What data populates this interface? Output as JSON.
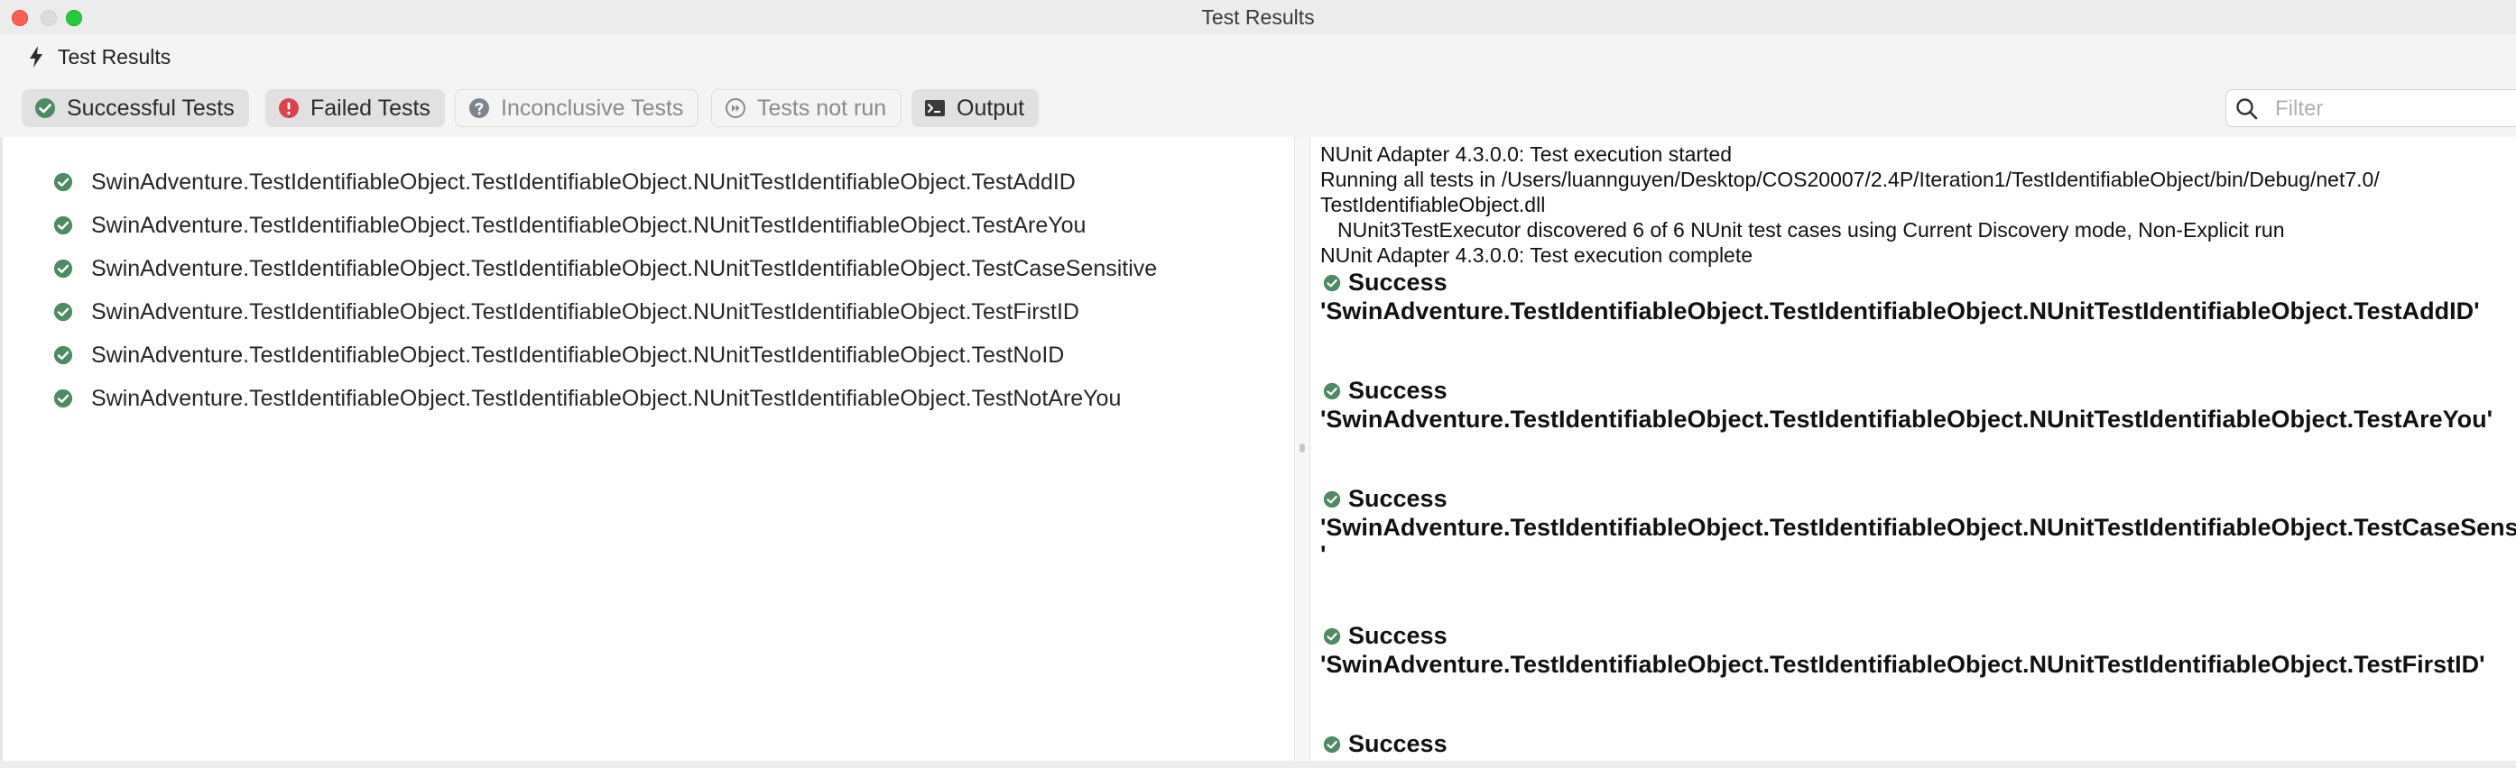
{
  "window": {
    "title": "Test Results"
  },
  "panel": {
    "title": "Test Results",
    "icon": "lightning-bolt-icon"
  },
  "toolbar": {
    "buttons": [
      {
        "label": "Successful Tests",
        "icon": "check-circle-icon",
        "active": true
      },
      {
        "label": "Failed Tests",
        "icon": "error-circle-icon",
        "active": true
      },
      {
        "label": "Inconclusive Tests",
        "icon": "question-circle-icon",
        "active": false
      },
      {
        "label": "Tests not run",
        "icon": "skip-circle-icon",
        "active": false
      },
      {
        "label": "Output",
        "icon": "terminal-icon",
        "active": true
      }
    ],
    "filter_placeholder": "Filter",
    "filter_value": ""
  },
  "tests": [
    {
      "name": "SwinAdventure.TestIdentifiableObject.TestIdentifiableObject.NUnitTestIdentifiableObject.TestAddID",
      "status": "success"
    },
    {
      "name": "SwinAdventure.TestIdentifiableObject.TestIdentifiableObject.NUnitTestIdentifiableObject.TestAreYou",
      "status": "success"
    },
    {
      "name": "SwinAdventure.TestIdentifiableObject.TestIdentifiableObject.NUnitTestIdentifiableObject.TestCaseSensitive",
      "status": "success"
    },
    {
      "name": "SwinAdventure.TestIdentifiableObject.TestIdentifiableObject.NUnitTestIdentifiableObject.TestFirstID",
      "status": "success"
    },
    {
      "name": "SwinAdventure.TestIdentifiableObject.TestIdentifiableObject.NUnitTestIdentifiableObject.TestNoID",
      "status": "success"
    },
    {
      "name": "SwinAdventure.TestIdentifiableObject.TestIdentifiableObject.NUnitTestIdentifiableObject.TestNotAreYou",
      "status": "success"
    }
  ],
  "output": {
    "log_lines": [
      "NUnit Adapter 4.3.0.0: Test execution started",
      "Running all tests in /Users/luannguyen/Desktop/COS20007/2.4P/Iteration1/TestIdentifiableObject/bin/Debug/net7.0/",
      "TestIdentifiableObject.dll",
      "NUnit3TestExecutor discovered 6 of 6 NUnit test cases using Current Discovery mode, Non-Explicit run",
      "NUnit Adapter 4.3.0.0: Test execution complete"
    ],
    "results": [
      {
        "status": "Success",
        "name": "'SwinAdventure.TestIdentifiableObject.TestIdentifiableObject.NUnitTestIdentifiableObject.TestAddID'"
      },
      {
        "status": "Success",
        "name": "'SwinAdventure.TestIdentifiableObject.TestIdentifiableObject.NUnitTestIdentifiableObject.TestAreYou'"
      },
      {
        "status": "Success",
        "name": "'SwinAdventure.TestIdentifiableObject.TestIdentifiableObject.NUnitTestIdentifiableObject.TestCaseSensitive",
        "wrap": "'"
      },
      {
        "status": "Success",
        "name": "'SwinAdventure.TestIdentifiableObject.TestIdentifiableObject.NUnitTestIdentifiableObject.TestFirstID'"
      },
      {
        "status": "Success"
      }
    ]
  },
  "colors": {
    "success": "#4e8a63",
    "failed": "#d9434e",
    "neutral": "#7d8591",
    "titlebar": "#ececec",
    "toolbar": "#f4f4f4"
  }
}
